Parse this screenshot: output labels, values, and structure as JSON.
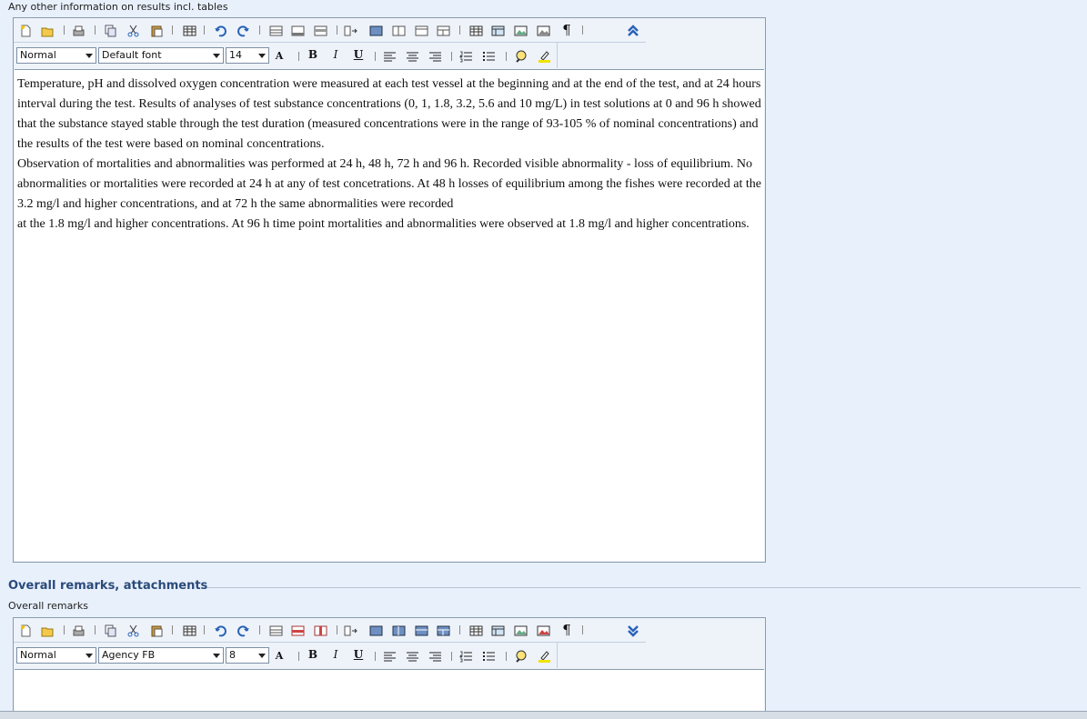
{
  "section1": {
    "label": "Any other information on results incl. tables",
    "toolbar": {
      "collapse_icon": "double-chevron-up-icon",
      "style_select": "Normal",
      "font_select": "Default font",
      "size_select": "14"
    },
    "content": [
      "Temperature, pH and dissolved oxygen concentration were measured at each test vessel at the beginning and at the end of the test, and at 24 hours interval during the test. Results of analyses of test substance concentrations (0, 1, 1.8, 3.2, 5.6 and 10 mg/L) in test solutions at 0 and 96 h showed that the substance stayed stable through the test duration (measured concentrations were in the range of 93-105 % of nominal concentrations) and the results of the test were based on nominal concentrations.",
      "Observation of mortalities and abnormalities was performed at 24 h, 48 h, 72 h and 96 h. Recorded visible abnormality - loss of equilibrium. No abnormalities or mortalities were recorded at 24 h at any of test concetrations. At 48 h losses of equilibrium among the fishes were recorded at the 3.2 mg/l and higher concentrations, and at 72 h the same abnormalities were recorded",
      "at the 1.8 mg/l and higher concentrations. At 96 h time point mortalities and abnormalities were observed at 1.8 mg/l and higher concentrations."
    ]
  },
  "section2": {
    "heading": "Overall remarks, attachments",
    "label": "Overall remarks",
    "toolbar": {
      "collapse_icon": "double-chevron-down-icon",
      "style_select": "Normal",
      "font_select": "Agency FB",
      "size_select": "8"
    },
    "content": ""
  },
  "toolbar_glyphs": {
    "bold": "B",
    "italic": "I",
    "underline": "U",
    "pilcrow": "¶",
    "font_size_a": "A"
  },
  "colors": {
    "background": "#e8f0fb",
    "heading": "#2a4a7a",
    "collapse_icon": "#2a63b8",
    "highlight_bar": "#f2e200"
  }
}
